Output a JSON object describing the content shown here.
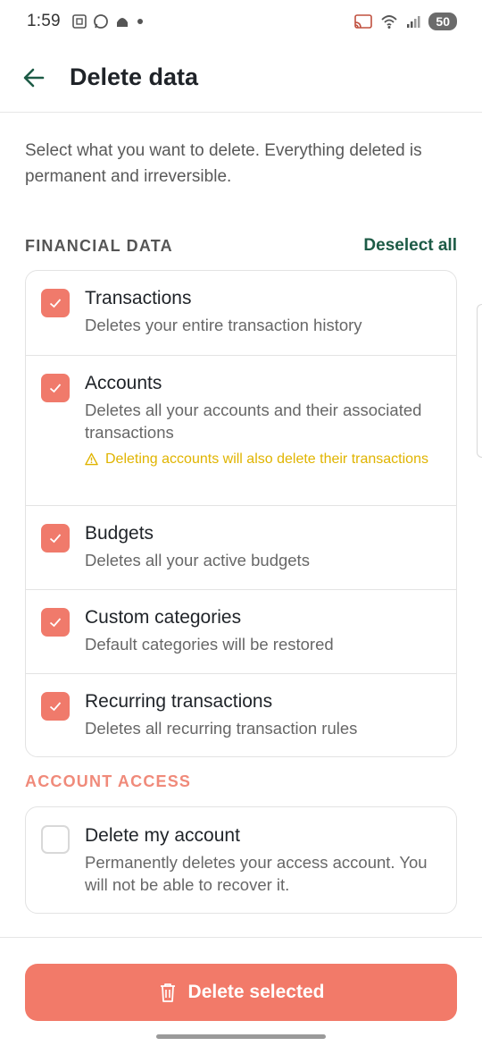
{
  "status_bar": {
    "time": "1:59",
    "battery": "50",
    "icons": [
      "screenshot-icon",
      "whatsapp-icon",
      "android-icon",
      "dot-icon",
      "cast-icon",
      "wifi-icon",
      "signal-icon"
    ]
  },
  "header": {
    "title": "Delete data",
    "back_icon": "arrow-left-icon"
  },
  "intro_text": "Select what you want to delete. Everything deleted is permanent and irreversible.",
  "financial": {
    "section_title": "FINANCIAL DATA",
    "deselect_label": "Deselect all",
    "items": [
      {
        "title": "Transactions",
        "description": "Deletes your entire transaction history",
        "checked": true
      },
      {
        "title": "Accounts",
        "description": "Deletes all your accounts and their associated transactions",
        "warning": "Deleting accounts will also delete their transactions",
        "checked": true
      },
      {
        "title": "Budgets",
        "description": "Deletes all your active budgets",
        "checked": true
      },
      {
        "title": "Custom categories",
        "description": "Default categories will be restored",
        "checked": true
      },
      {
        "title": "Recurring transactions",
        "description": "Deletes all recurring transaction rules",
        "checked": true
      }
    ]
  },
  "account_access": {
    "section_title": "ACCOUNT ACCESS",
    "items": [
      {
        "title": "Delete my account",
        "description": "Permanently deletes your access account. You will not be able to recover it.",
        "checked": false
      }
    ]
  },
  "delete_button": {
    "label": "Delete selected",
    "icon": "trash-icon"
  },
  "colors": {
    "accent": "#f07a6b",
    "primary_green": "#1d5b46",
    "warning": "#e0b400"
  }
}
